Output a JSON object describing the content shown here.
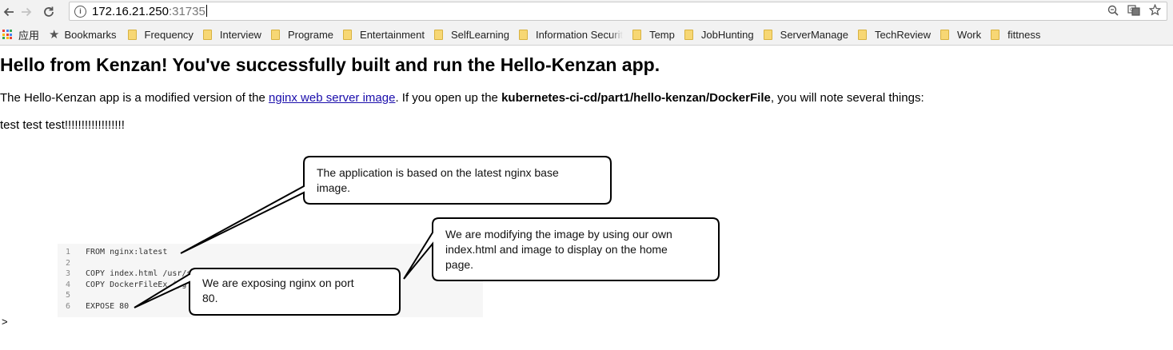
{
  "browser": {
    "url_host": "172.16.21.250",
    "url_port": ":31735",
    "nav": {
      "back": "back-arrow-icon",
      "forward": "forward-arrow-icon",
      "reload": "reload-icon"
    },
    "omnibox_icons": [
      "zoom-icon",
      "translate-icon",
      "bookmark-star-icon"
    ]
  },
  "bookmarks": {
    "apps_label": "应用",
    "items": [
      {
        "label": "Bookmarks",
        "icon": "star-icon"
      },
      {
        "label": "Frequency",
        "icon": "folder-icon"
      },
      {
        "label": "Interview",
        "icon": "folder-icon"
      },
      {
        "label": "Programe",
        "icon": "folder-icon"
      },
      {
        "label": "Entertainment",
        "icon": "folder-icon"
      },
      {
        "label": "SelfLearning",
        "icon": "folder-icon"
      },
      {
        "label": "Information Securit",
        "icon": "folder-icon"
      },
      {
        "label": "Temp",
        "icon": "folder-icon"
      },
      {
        "label": "JobHunting",
        "icon": "folder-icon"
      },
      {
        "label": "ServerManage",
        "icon": "folder-icon"
      },
      {
        "label": "TechReview",
        "icon": "folder-icon"
      },
      {
        "label": "Work",
        "icon": "folder-icon"
      },
      {
        "label": "fittness",
        "icon": "folder-icon"
      }
    ]
  },
  "page": {
    "heading": "Hello from Kenzan! You've successfully built and run the Hello-Kenzan app.",
    "intro_pre": "The Hello-Kenzan app is a modified version of the ",
    "intro_link": "nginx web server image",
    "intro_mid": ". If you open up the ",
    "intro_bold": "kubernetes-ci-cd/part1/hello-kenzan/DockerFile",
    "intro_post": ", you will note several things:",
    "test_line": "test test test!!!!!!!!!!!!!!!!!!",
    "tail": ">"
  },
  "figure": {
    "code_lines": [
      {
        "n": "1",
        "text": "FROM nginx:latest"
      },
      {
        "n": "2",
        "text": ""
      },
      {
        "n": "3",
        "text": "COPY index.html /usr/share/nginx/html/index.html"
      },
      {
        "n": "4",
        "text": "COPY DockerFileEx.jpg /usr/share/nginx/html/DockerFileEx.jpg"
      },
      {
        "n": "5",
        "text": ""
      },
      {
        "n": "6",
        "text": "EXPOSE 80"
      }
    ],
    "callouts": [
      {
        "line1": "The application is based on the latest nginx base",
        "line2": "image."
      },
      {
        "line1": "We are modifying the image by using our own",
        "line2": "index.html and image to display on the home",
        "line3": "page."
      },
      {
        "line1": "We are exposing nginx on port",
        "line2": "80."
      }
    ]
  },
  "colors": {
    "link": "#1a0dab",
    "folder": "#f7d774",
    "apps_grid": [
      "#e94235",
      "#4285f4",
      "#34a853",
      "#fbbc05"
    ]
  }
}
